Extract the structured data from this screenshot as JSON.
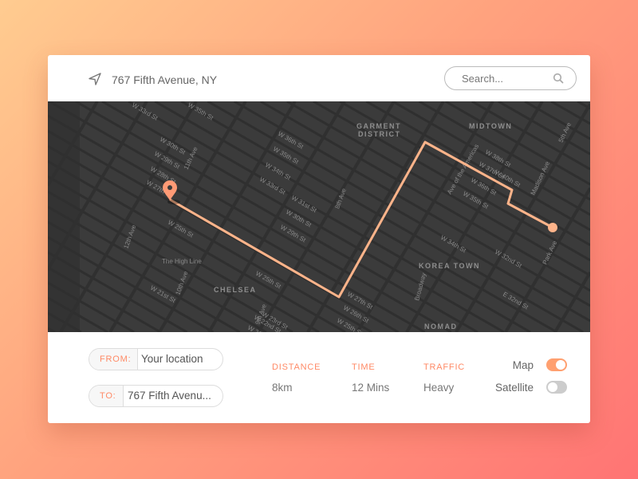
{
  "header": {
    "location": "767 Fifth Avenue, NY",
    "location_icon": "navigation-arrow-icon",
    "search_placeholder": "Search...",
    "search_icon": "magnifier-icon"
  },
  "map": {
    "districts": [
      "GARMENT",
      "DISTRICT",
      "MIDTOWN",
      "KOREA TOWN",
      "CHELSEA",
      "NOMAD"
    ],
    "labels": [
      "The High Line",
      "W 33rd St",
      "W 35th St",
      "W 30th St",
      "W 29th St",
      "W 28th St",
      "W 27th St",
      "W 25th St",
      "11th Ave",
      "12th Ave",
      "10th Ave",
      "W 21st St",
      "9th Ave",
      "W 36th St",
      "W 35th St",
      "W 34th St",
      "W 33rd St",
      "8th Ave",
      "W 31st St",
      "W 30th St",
      "W 29th St",
      "W 25th St",
      "W 23rd St",
      "W 22nd St",
      "W 21st St",
      "W 27th St",
      "W 26th St",
      "W 25th St",
      "Broadway",
      "W 38th St",
      "W 37th St",
      "W 36th St",
      "W 35th St",
      "W 34th St",
      "Ave of the Americas",
      "W 40th St",
      "Madison Ave",
      "5th Ave",
      "Park Ave",
      "W 32nd St",
      "E 32nd St"
    ],
    "route_color": "#ffb48a",
    "pin_color": "#ff9a75"
  },
  "route": {
    "from_label": "FROM:",
    "from_value": "Your location",
    "to_label": "TO:",
    "to_value": "767 Fifth Avenu..."
  },
  "stats": [
    {
      "label": "DISTANCE",
      "value": "8km"
    },
    {
      "label": "TIME",
      "value": "12 Mins"
    },
    {
      "label": "TRAFFIC",
      "value": "Heavy"
    }
  ],
  "view_toggles": [
    {
      "label": "Map",
      "on": true
    },
    {
      "label": "Satellite",
      "on": false
    }
  ],
  "colors": {
    "accent": "#ff8a66",
    "toggle_on": "#ffa070",
    "toggle_off": "#cccccc"
  }
}
